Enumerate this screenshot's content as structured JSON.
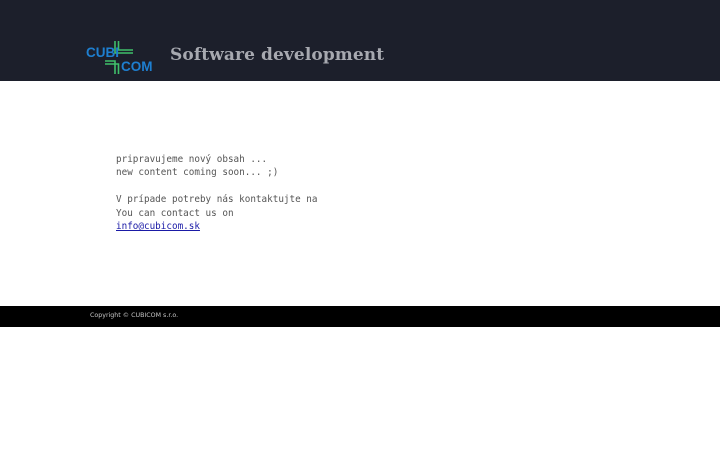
{
  "header": {
    "logo_top": "CUBI",
    "logo_bottom": "COM",
    "title": "Software development"
  },
  "content": {
    "line1": "pripravujeme nový obsah ...",
    "line2": "new content coming soon... ;)",
    "line3": "V prípade potreby nás kontaktujte na",
    "line4": "You can contact us on",
    "email": "info@cubicom.sk"
  },
  "footer": {
    "copyright": "Copyright © CUBICOM s.r.o."
  },
  "colors": {
    "header_bg": "#1c1f2b",
    "logo_blue": "#1e7fd0",
    "logo_green": "#3fbf6a",
    "footer_bg": "#000000"
  }
}
